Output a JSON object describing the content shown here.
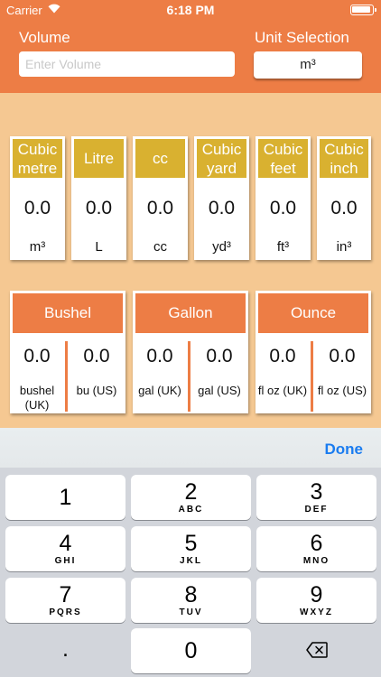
{
  "status": {
    "carrier": "Carrier",
    "time": "6:18 PM"
  },
  "header": {
    "volume_label": "Volume",
    "volume_placeholder": "Enter Volume",
    "unit_label": "Unit Selection",
    "unit_selected": "m³"
  },
  "metric_cards": [
    {
      "title": "Cubic metre",
      "value": "0.0",
      "unit": "m³"
    },
    {
      "title": "Litre",
      "value": "0.0",
      "unit": "L"
    },
    {
      "title": "cc",
      "value": "0.0",
      "unit": "cc"
    },
    {
      "title": "Cubic yard",
      "value": "0.0",
      "unit": "yd³"
    },
    {
      "title": "Cubic feet",
      "value": "0.0",
      "unit": "ft³"
    },
    {
      "title": "Cubic inch",
      "value": "0.0",
      "unit": "in³"
    }
  ],
  "pair_cards": [
    {
      "title": "Bushel",
      "left": {
        "value": "0.0",
        "unit": "bushel (UK)"
      },
      "right": {
        "value": "0.0",
        "unit": "bu (US)"
      }
    },
    {
      "title": "Gallon",
      "left": {
        "value": "0.0",
        "unit": "gal (UK)"
      },
      "right": {
        "value": "0.0",
        "unit": "gal (US)"
      }
    },
    {
      "title": "Ounce",
      "left": {
        "value": "0.0",
        "unit": "fl oz (UK)"
      },
      "right": {
        "value": "0.0",
        "unit": "fl oz (US)"
      }
    }
  ],
  "keyboard": {
    "done_label": "Done",
    "keys": [
      {
        "num": "1",
        "letters": ""
      },
      {
        "num": "2",
        "letters": "ABC"
      },
      {
        "num": "3",
        "letters": "DEF"
      },
      {
        "num": "4",
        "letters": "GHI"
      },
      {
        "num": "5",
        "letters": "JKL"
      },
      {
        "num": "6",
        "letters": "MNO"
      },
      {
        "num": "7",
        "letters": "PQRS"
      },
      {
        "num": "8",
        "letters": "TUV"
      },
      {
        "num": "9",
        "letters": "WXYZ"
      },
      {
        "num": ".",
        "letters": ""
      },
      {
        "num": "0",
        "letters": ""
      }
    ],
    "delete_icon": "backspace-icon"
  },
  "colors": {
    "accent": "#ed7d45",
    "gold": "#d9b130",
    "background": "#f5c892",
    "done": "#1a7cf0"
  }
}
